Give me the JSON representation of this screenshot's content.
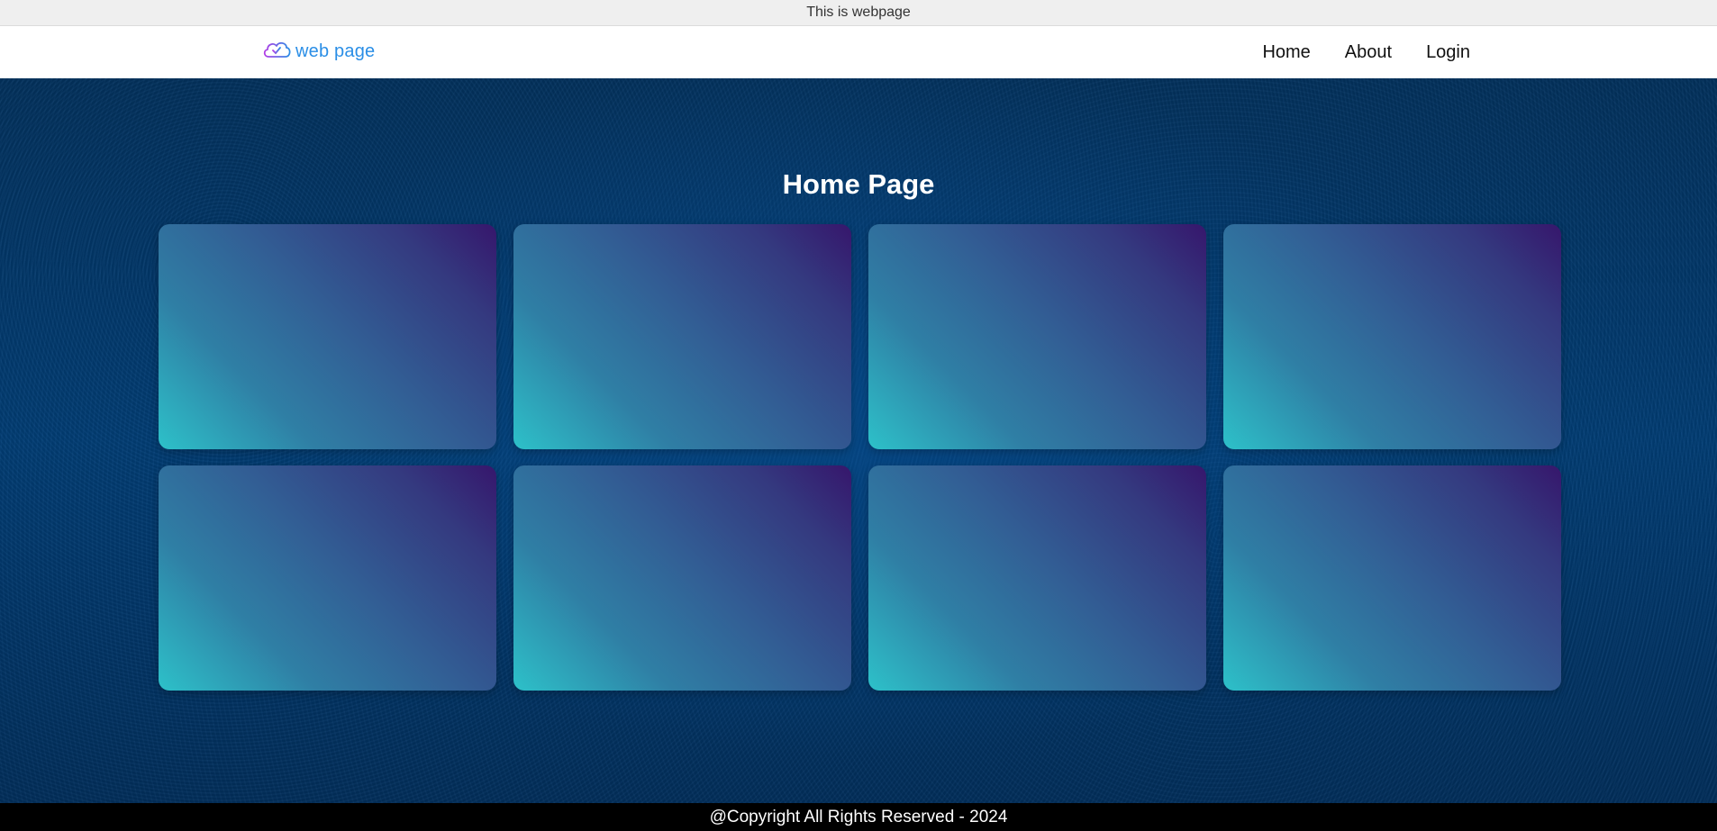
{
  "browser_bar": {
    "text": "This is webpage"
  },
  "header": {
    "logo_text": "web page",
    "logo_icon": "cloud-check-icon",
    "nav": [
      {
        "label": "Home"
      },
      {
        "label": "About"
      },
      {
        "label": "Login"
      }
    ]
  },
  "main": {
    "title": "Home Page",
    "cards": [
      {},
      {},
      {},
      {},
      {},
      {},
      {},
      {}
    ]
  },
  "footer": {
    "text": "@Copyright All Rights Reserved - 2024"
  },
  "colors": {
    "logo": "#2a8ee6",
    "background": "#023e76",
    "card_gradient_start": "#2dc1c9",
    "card_gradient_end": "#36166c",
    "footer_bg": "#000000"
  }
}
